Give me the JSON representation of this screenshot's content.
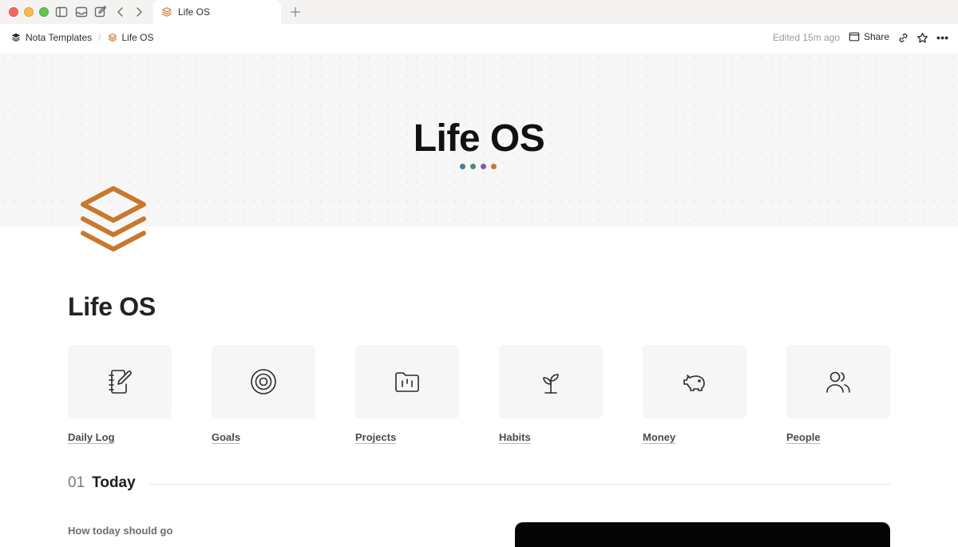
{
  "window": {
    "tab_title": "Life OS"
  },
  "toolbar": {
    "breadcrumb": [
      "Nota Templates",
      "Life OS"
    ],
    "edited": "Edited 15m ago",
    "share_label": "Share"
  },
  "cover": {
    "title": "Life OS",
    "dot_colors": [
      "#4d79a0",
      "#4e8a6a",
      "#7a5aa6",
      "#c8782f"
    ]
  },
  "page": {
    "icon": "stack-layers-icon",
    "icon_color": "#c8782f",
    "heading": "Life OS"
  },
  "cards": [
    {
      "label": "Daily Log",
      "icon": "notebook-pen-icon"
    },
    {
      "label": "Goals",
      "icon": "target-icon"
    },
    {
      "label": "Projects",
      "icon": "folder-chart-icon"
    },
    {
      "label": "Habits",
      "icon": "sprout-icon"
    },
    {
      "label": "Money",
      "icon": "piggy-bank-icon"
    },
    {
      "label": "People",
      "icon": "users-icon"
    }
  ],
  "section": {
    "number": "01",
    "title": "Today"
  },
  "subtext": "How today should go"
}
